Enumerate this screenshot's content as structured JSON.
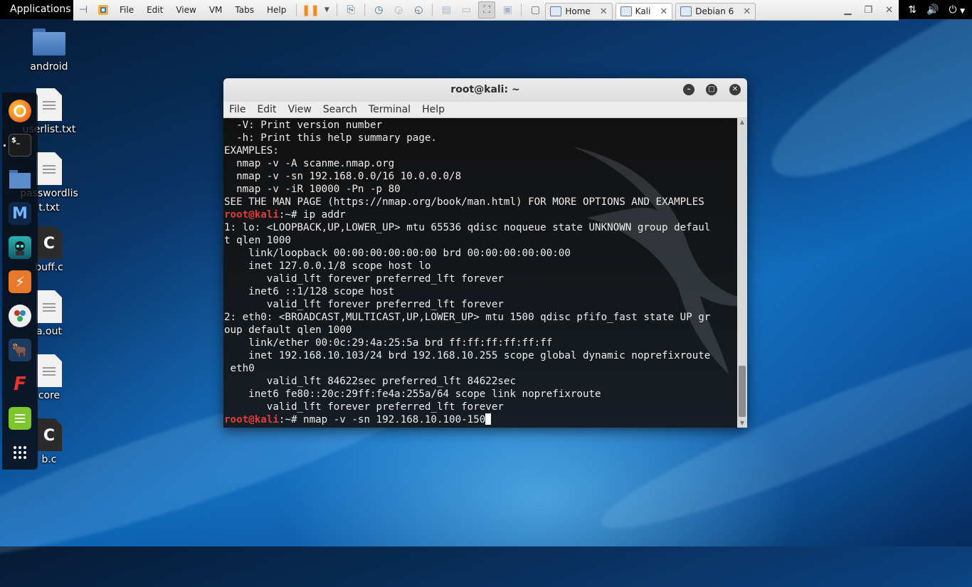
{
  "topbar": {
    "applications_label": "Applications"
  },
  "vmware": {
    "menus": [
      "File",
      "Edit",
      "View",
      "VM",
      "Tabs",
      "Help"
    ],
    "tabs": [
      {
        "label": "Home",
        "active": false
      },
      {
        "label": "Kali",
        "active": true
      },
      {
        "label": "Debian 6",
        "active": false
      }
    ]
  },
  "desktop": {
    "icons": [
      {
        "label": "android",
        "type": "folder"
      },
      {
        "label": "userlist.txt",
        "type": "text"
      },
      {
        "label": "passwordlist.txt",
        "type": "text"
      },
      {
        "label": "buff.c",
        "type": "c"
      },
      {
        "label": "a.out",
        "type": "text"
      },
      {
        "label": "core",
        "type": "text"
      },
      {
        "label": "b.c",
        "type": "c"
      }
    ]
  },
  "dock": {
    "items": [
      "firefox-icon",
      "terminal-icon",
      "files-icon",
      "metasploit-icon",
      "armitage-icon",
      "burpsuite-icon",
      "maltego-icon",
      "beef-icon",
      "faraday-icon",
      "leafpad-icon",
      "show-apps-icon"
    ]
  },
  "terminal": {
    "title": "root@kali: ~",
    "menus": [
      "File",
      "Edit",
      "View",
      "Search",
      "Terminal",
      "Help"
    ],
    "prompt_user": "root@kali",
    "prompt_suffix": ":~# ",
    "lines": [
      {
        "text": "  -V: Print version number"
      },
      {
        "text": "  -h: Print this help summary page."
      },
      {
        "text": "EXAMPLES:"
      },
      {
        "text": "  nmap -v -A scanme.nmap.org"
      },
      {
        "text": "  nmap -v -sn 192.168.0.0/16 10.0.0.0/8"
      },
      {
        "text": "  nmap -v -iR 10000 -Pn -p 80"
      },
      {
        "text": "SEE THE MAN PAGE (https://nmap.org/book/man.html) FOR MORE OPTIONS AND EXAMPLES"
      },
      {
        "prompt": true,
        "text": "ip addr"
      },
      {
        "text": "1: lo: <LOOPBACK,UP,LOWER_UP> mtu 65536 qdisc noqueue state UNKNOWN group defaul"
      },
      {
        "text": "t qlen 1000"
      },
      {
        "text": "    link/loopback 00:00:00:00:00:00 brd 00:00:00:00:00:00"
      },
      {
        "text": "    inet 127.0.0.1/8 scope host lo"
      },
      {
        "text": "       valid_lft forever preferred_lft forever"
      },
      {
        "text": "    inet6 ::1/128 scope host"
      },
      {
        "text": "       valid_lft forever preferred_lft forever"
      },
      {
        "text": "2: eth0: <BROADCAST,MULTICAST,UP,LOWER_UP> mtu 1500 qdisc pfifo_fast state UP gr"
      },
      {
        "text": "oup default qlen 1000"
      },
      {
        "text": "    link/ether 00:0c:29:4a:25:5a brd ff:ff:ff:ff:ff:ff"
      },
      {
        "text": "    inet 192.168.10.103/24 brd 192.168.10.255 scope global dynamic noprefixroute"
      },
      {
        "text": " eth0"
      },
      {
        "text": "       valid_lft 84622sec preferred_lft 84622sec"
      },
      {
        "text": "    inet6 fe80::20c:29ff:fe4a:255a/64 scope link noprefixroute"
      },
      {
        "text": "       valid_lft forever preferred_lft forever"
      },
      {
        "prompt": true,
        "text": "nmap -v -sn 192.168.10.100-150",
        "cursor": true
      }
    ]
  },
  "colors": {
    "prompt_red": "#e03c3c",
    "pause_orange": "#f08a1c"
  }
}
